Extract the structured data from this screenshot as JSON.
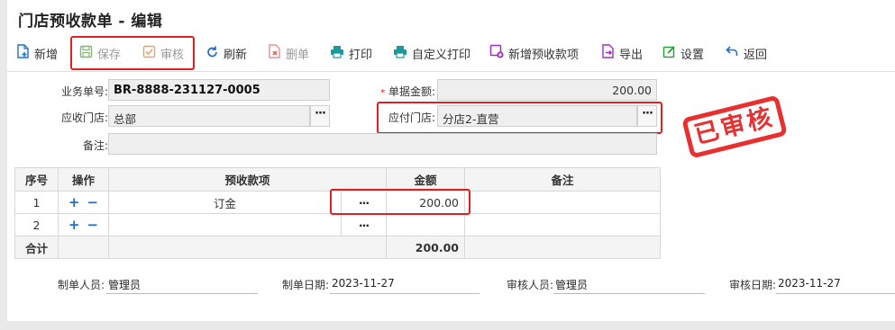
{
  "window": {
    "title": "门店预收款单 - 编辑"
  },
  "toolbar": {
    "items": [
      {
        "label": "新增",
        "icon": "add-doc-icon",
        "enabled": true
      },
      {
        "label": "保存",
        "icon": "save-icon",
        "enabled": false
      },
      {
        "label": "审核",
        "icon": "audit-icon",
        "enabled": false
      },
      {
        "label": "刷新",
        "icon": "refresh-icon",
        "enabled": true
      },
      {
        "label": "删单",
        "icon": "delete-doc-icon",
        "enabled": false
      },
      {
        "label": "打印",
        "icon": "print-icon",
        "enabled": true
      },
      {
        "label": "自定义打印",
        "icon": "custom-print-icon",
        "enabled": true
      },
      {
        "label": "新增预收款项",
        "icon": "add-item-icon",
        "enabled": true
      },
      {
        "label": "导出",
        "icon": "export-icon",
        "enabled": true
      },
      {
        "label": "设置",
        "icon": "settings-icon",
        "enabled": true
      },
      {
        "label": "返回",
        "icon": "back-icon",
        "enabled": true
      }
    ]
  },
  "form": {
    "doc_no_label": "业务单号:",
    "doc_no_value": "BR-8888-231127-0005",
    "amount_required": "*",
    "amount_label": "单据金额:",
    "amount_value": "200.00",
    "recv_store_label": "应收门店:",
    "recv_store_value": "总部",
    "pay_store_label": "应付门店:",
    "pay_store_value": "分店2-直营",
    "remark_label": "备注:",
    "remark_value": "",
    "ellipsis": "···"
  },
  "stamp": {
    "text": "已审核"
  },
  "grid": {
    "headers": [
      "序号",
      "操作",
      "预收款项",
      "金额",
      "备注"
    ],
    "rows": [
      {
        "no": "1",
        "item": "订金",
        "amount": "200.00",
        "remark": ""
      },
      {
        "no": "2",
        "item": "",
        "amount": "",
        "remark": ""
      }
    ],
    "add_symbol": "+",
    "remove_symbol": "−",
    "total_label": "合计",
    "total_amount": "200.00"
  },
  "footer": {
    "maker_label": "制单人员:",
    "maker_value": "管理员",
    "make_date_label": "制单日期:",
    "make_date_value": "2023-11-27",
    "auditor_label": "审核人员:",
    "auditor_value": "管理员",
    "audit_date_label": "审核日期:",
    "audit_date_value": "2023-11-27"
  },
  "colors": {
    "accent_blue": "#1e6fd1",
    "highlight_red": "#e02020",
    "print_teal": "#1a9a9a",
    "green": "#2e9e3a",
    "purple": "#9b30c0",
    "orange": "#e07a30"
  }
}
